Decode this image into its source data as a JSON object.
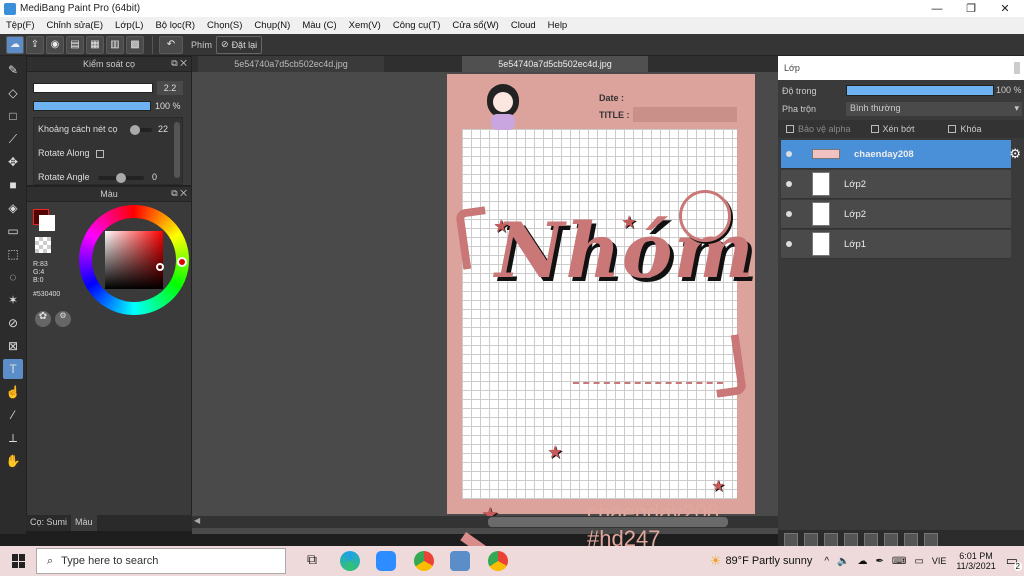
{
  "window": {
    "title": "MediBang Paint Pro (64bit)"
  },
  "menu": [
    "Tệp(F)",
    "Chỉnh sửa(E)",
    "Lớp(L)",
    "Bộ lọc(R)",
    "Chọn(S)",
    "Chụp(N)",
    "Màu (C)",
    "Xem(V)",
    "Công cụ(T)",
    "Cửa sổ(W)",
    "Cloud",
    "Help"
  ],
  "toolbar": {
    "phim_label": "Phím",
    "reset_label": "Đặt lại"
  },
  "brush_panel": {
    "title": "Kiểm soát cọ",
    "size_value": "2.2",
    "opacity_value": "100 %",
    "spacing_label": "Khoảng cách nét cọ",
    "spacing_value": "22",
    "rotate_along_label": "Rotate Along",
    "rotate_angle_label": "Rotate Angle",
    "rotate_angle_value": "0"
  },
  "color_panel": {
    "title": "Màu",
    "r": "R:83",
    "g": "G:4",
    "b": "B:0",
    "hex": "#530400",
    "wheel_color": "#530400"
  },
  "bottom_tabs": [
    "Cọ: Sumi",
    "Màu"
  ],
  "tabs": [
    "5e54740a7d5cb502ec4d.jpg",
    "5e54740a7d5cb502ec4d.jpg"
  ],
  "artwork": {
    "date_label": "Date :",
    "title_label": "TITLE :",
    "headline": "Nhóm",
    "author": "chaenday208",
    "tag": "#hd247"
  },
  "layer_panel": {
    "title": "Lớp",
    "opacity_label": "Độ trong",
    "opacity_value": "100 %",
    "blend_label": "Pha trộn",
    "blend_value": "Bình thường",
    "protect_alpha": "Bảo vệ alpha",
    "clip": "Xén bớt",
    "lock": "Khóa",
    "layers": [
      "chaenday208",
      "Lớp2",
      "Lớp2",
      "Lớp1"
    ]
  },
  "taskbar": {
    "search_placeholder": "Type here to search",
    "weather": "89°F Partly sunny",
    "lang": "VIE",
    "time": "6:01 PM",
    "date": "11/3/2021",
    "notifications": "2"
  }
}
